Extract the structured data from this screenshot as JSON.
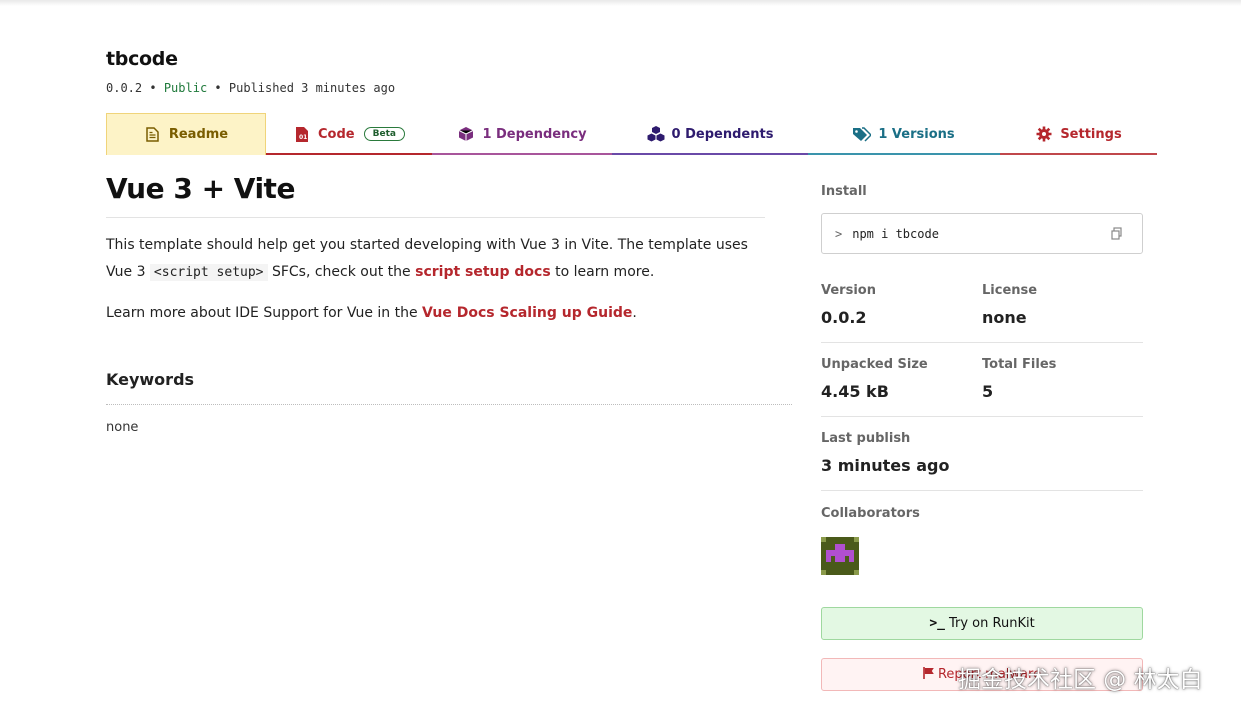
{
  "package": {
    "name": "tbcode",
    "version": "0.0.2",
    "visibility": "Public",
    "published": "Published 3 minutes ago",
    "sep": "•"
  },
  "tabs": {
    "readme": "Readme",
    "code": "Code",
    "code_badge": "Beta",
    "dependency": "1 Dependency",
    "dependents": "0 Dependents",
    "versions": "1 Versions",
    "settings": "Settings"
  },
  "readme": {
    "title": "Vue 3 + Vite",
    "p1_a": "This template should help get you started developing with Vue 3 in Vite. The template uses Vue 3 ",
    "p1_code": "<script setup>",
    "p1_b": " SFCs, check out the ",
    "p1_link": "script setup docs",
    "p1_c": " to learn more.",
    "p2_a": "Learn more about IDE Support for Vue in the ",
    "p2_link": "Vue Docs Scaling up Guide",
    "p2_b": ".",
    "keywords_heading": "Keywords",
    "keywords_value": "none"
  },
  "sidebar": {
    "install_label": "Install",
    "install_chevron": ">",
    "install_cmd": "npm i tbcode",
    "version_label": "Version",
    "version_value": "0.0.2",
    "license_label": "License",
    "license_value": "none",
    "size_label": "Unpacked Size",
    "size_value": "4.45 kB",
    "files_label": "Total Files",
    "files_value": "5",
    "publish_label": "Last publish",
    "publish_value": "3 minutes ago",
    "collab_label": "Collaborators",
    "runkit_prompt": ">_",
    "runkit_label": "Try on RunKit",
    "report_label": "Report malware"
  },
  "watermark": "掘金技术社区 @ 林太白",
  "colors": {
    "readme_tab": "#fdf3c7",
    "code": "#b5272d",
    "dependency": "#7a2e7e",
    "dependents": "#2e1b6e",
    "versions": "#1a6f86",
    "public": "#207a3c"
  }
}
